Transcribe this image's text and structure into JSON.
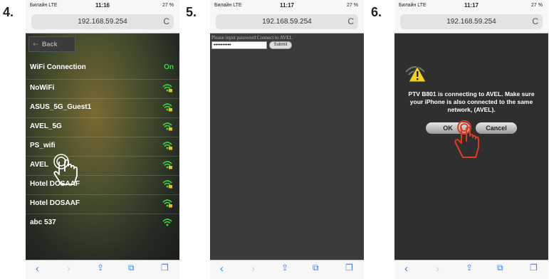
{
  "steps": [
    "4.",
    "5.",
    "6."
  ],
  "status": {
    "carrier": "Билайн LTE",
    "battery": "27 %",
    "time4": "11:16",
    "time5": "11:17",
    "time6": "11:17"
  },
  "url": "192.168.59.254",
  "reload_glyph": "C",
  "phone4": {
    "back_label": "Back",
    "header": {
      "title": "WiFi Connection",
      "state": "On"
    },
    "networks": [
      {
        "name": "NoWiFi",
        "locked": true
      },
      {
        "name": "ASUS_5G_Guest1",
        "locked": true
      },
      {
        "name": "AVEL_5G",
        "locked": true
      },
      {
        "name": "PS_wifi",
        "locked": true
      },
      {
        "name": "AVEL",
        "locked": true
      },
      {
        "name": "Hotel DOSAAF",
        "locked": true
      },
      {
        "name": "Hotel DOSAAF",
        "locked": true
      },
      {
        "name": "abc 537",
        "locked": false
      }
    ]
  },
  "phone5": {
    "prompt": "Please input password Connect to AVEL",
    "password_value": "••••••••••",
    "submit_label": "Submit"
  },
  "phone6": {
    "message": "PTV B801 is connecting to AVEL. Make sure your iPhone is also connected to the same network, (AVEL).",
    "ok_label": "OK",
    "cancel_label": "Cancel"
  },
  "colors": {
    "accent": "#3b7bf7",
    "wifi_green": "#3fd23f",
    "hand_red": "#e23a22"
  },
  "icons": [
    "chevron-left-icon",
    "chevron-right-icon",
    "share-icon",
    "bookmarks-icon",
    "tabs-icon",
    "wifi-lock-icon",
    "warning-icon",
    "tap-hand-icon"
  ]
}
